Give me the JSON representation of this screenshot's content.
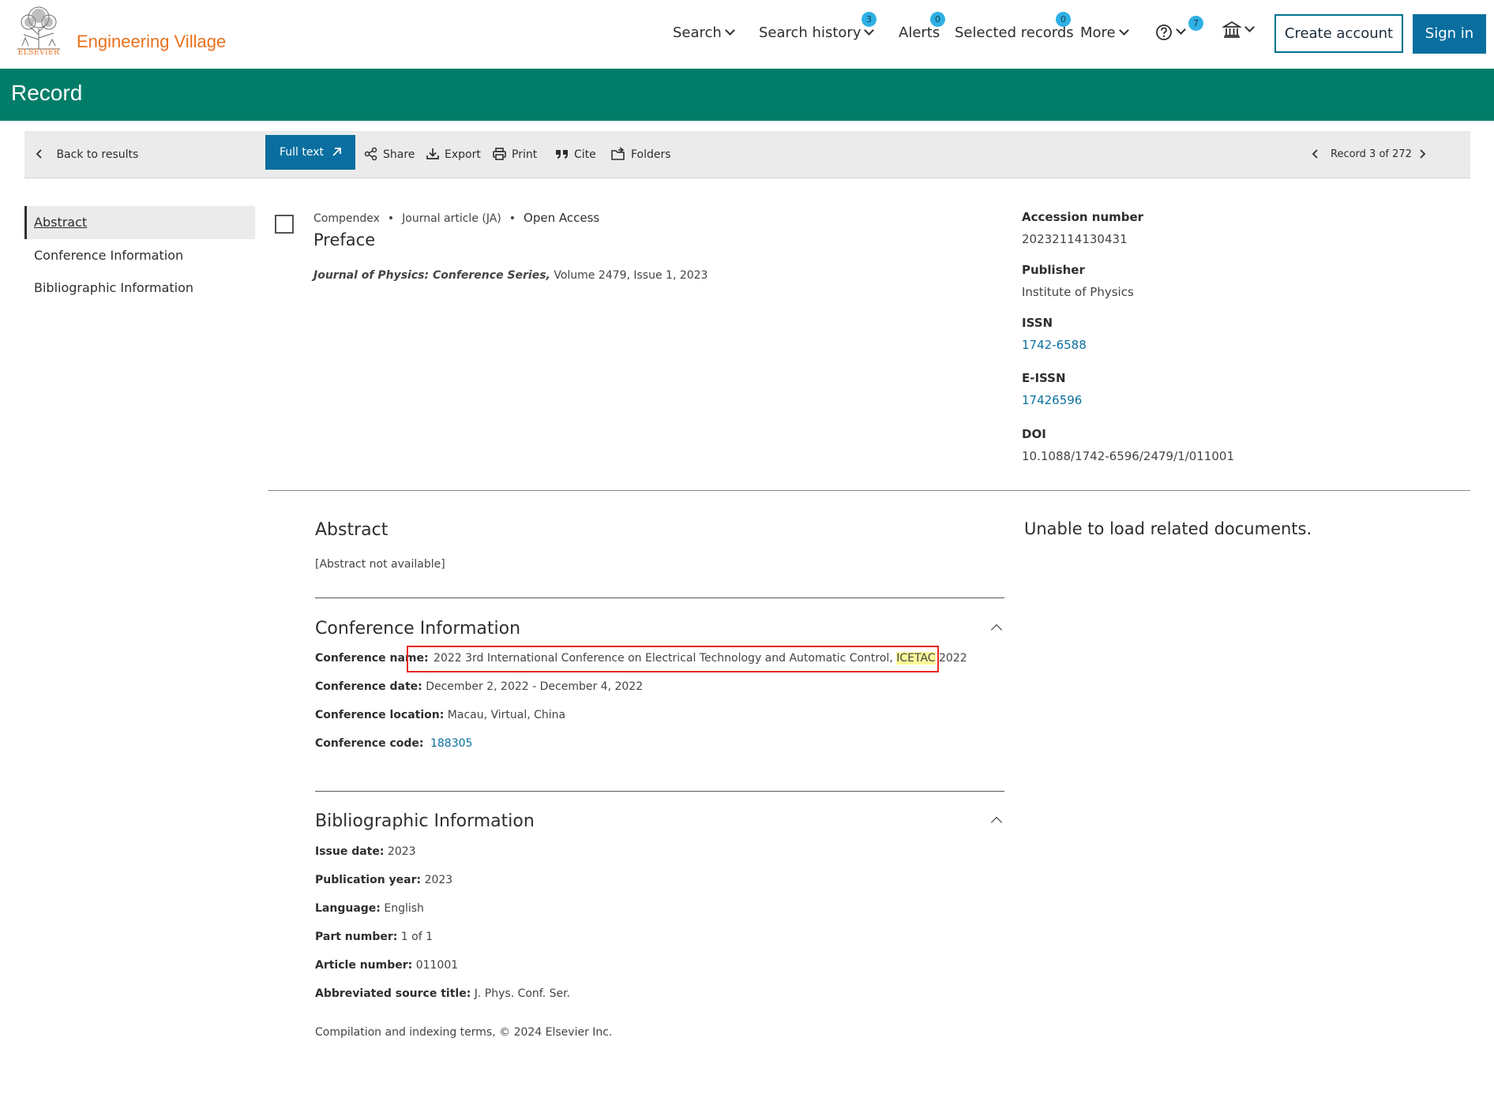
{
  "header": {
    "logo_word": "ELSEVIER",
    "brand": "Engineering Village",
    "nav": {
      "search": "Search",
      "search_history": "Search history",
      "search_history_badge": "3",
      "alerts": "Alerts",
      "alerts_badge": "0",
      "selected_records": "Selected records",
      "selected_records_badge": "0",
      "more": "More",
      "help_badge": "7"
    },
    "create_account": "Create account",
    "sign_in": "Sign in"
  },
  "banner": {
    "title": "Record"
  },
  "toolbar": {
    "back": "Back to results",
    "full_text": "Full text",
    "share": "Share",
    "export": "Export",
    "print": "Print",
    "cite": "Cite",
    "folders": "Folders",
    "record_position": "Record 3 of 272"
  },
  "sidenav": {
    "items": [
      "Abstract",
      "Conference Information",
      "Bibliographic Information"
    ]
  },
  "record": {
    "database": "Compendex",
    "doc_type": "Journal article (JA)",
    "access": "Open Access",
    "title": "Preface",
    "source_journal": "Journal of Physics: Conference Series,",
    "source_details": " Volume 2479, Issue 1, 2023"
  },
  "details": {
    "accession_label": "Accession number",
    "accession_value": "20232114130431",
    "publisher_label": "Publisher",
    "publisher_value": "Institute of Physics",
    "issn_label": "ISSN",
    "issn_value": "1742-6588",
    "eissn_label": "E-ISSN",
    "eissn_value": "17426596",
    "doi_label": "DOI",
    "doi_value": "10.1088/1742-6596/2479/1/011001"
  },
  "abstract": {
    "heading": "Abstract",
    "text": "[Abstract not available]"
  },
  "related": {
    "message": "Unable to load related documents."
  },
  "conference": {
    "heading": "Conference Information",
    "name_label": "Conference name:",
    "name_value_pre": "2022 3rd International Conference on Electrical Technology and Automatic Control, ",
    "name_value_hl": "ICETAC",
    "name_value_post": " 2022",
    "date_label": "Conference date:",
    "date_value": "December 2, 2022 - December 4, 2022",
    "location_label": "Conference location:",
    "location_value": "Macau, Virtual, China",
    "code_label": "Conference code:",
    "code_value": "188305"
  },
  "bibliographic": {
    "heading": "Bibliographic Information",
    "fields": [
      {
        "label": "Issue date:",
        "value": "2023"
      },
      {
        "label": "Publication year:",
        "value": "2023"
      },
      {
        "label": "Language:",
        "value": "English"
      },
      {
        "label": "Part number:",
        "value": "1 of 1"
      },
      {
        "label": "Article number:",
        "value": "011001"
      },
      {
        "label": "Abbreviated source title:",
        "value": "J. Phys. Conf. Ser."
      }
    ]
  },
  "footer": {
    "note": "Compilation and indexing terms, © 2024 Elsevier Inc."
  },
  "colors": {
    "brand_orange": "#e9711c",
    "banner_green": "#007d68",
    "primary_blue": "#0a6fa0",
    "badge_blue": "#2eb0e4",
    "highlight_yellow": "#fbf89a",
    "annotation_red": "#e8281f"
  }
}
